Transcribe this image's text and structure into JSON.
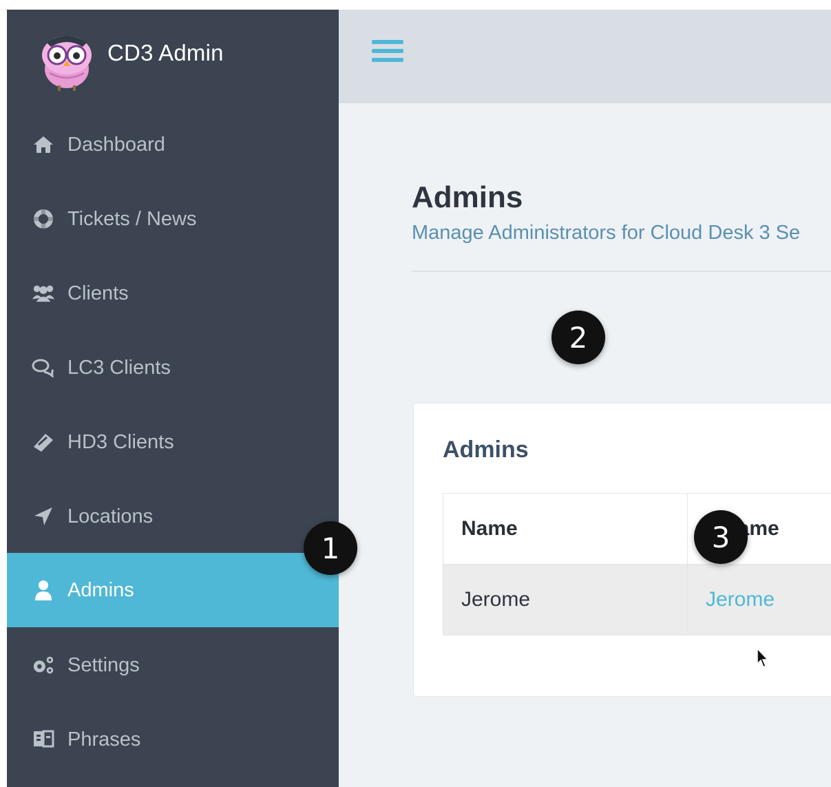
{
  "brand": {
    "title": "CD3 Admin"
  },
  "sidebar": {
    "items": [
      {
        "label": "Dashboard",
        "icon": "home-icon"
      },
      {
        "label": "Tickets / News",
        "icon": "life-ring-icon"
      },
      {
        "label": "Clients",
        "icon": "users-icon"
      },
      {
        "label": "LC3 Clients",
        "icon": "chat-bubbles-icon"
      },
      {
        "label": "HD3 Clients",
        "icon": "ticket-icon"
      },
      {
        "label": "Locations",
        "icon": "location-arrow-icon"
      },
      {
        "label": "Admins",
        "icon": "user-icon",
        "active": true
      },
      {
        "label": "Settings",
        "icon": "gears-icon"
      },
      {
        "label": "Phrases",
        "icon": "translate-book-icon"
      }
    ]
  },
  "page": {
    "title": "Admins",
    "subtitle": "Manage Administrators for Cloud Desk 3 Se"
  },
  "card": {
    "title": "Admins",
    "table": {
      "headers": [
        "Name",
        "ername"
      ],
      "rows": [
        {
          "name": "Jerome",
          "username": "Jerome"
        }
      ]
    }
  },
  "callouts": [
    "1",
    "2",
    "3"
  ],
  "colors": {
    "sidebar_bg": "#3b4450",
    "accent": "#4fb8d6",
    "header_bg": "#d9dee5",
    "content_bg": "#eef2f5"
  }
}
